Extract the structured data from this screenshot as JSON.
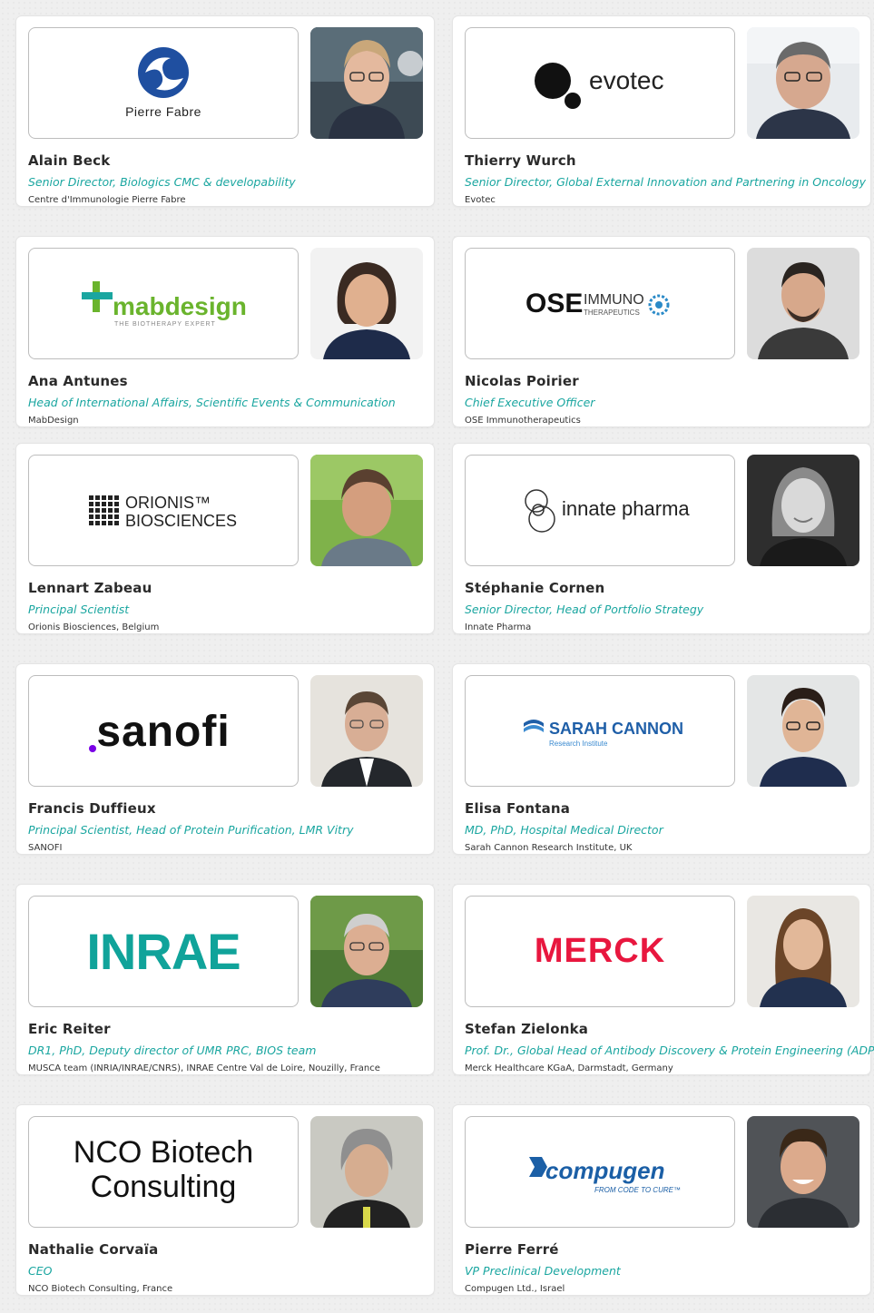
{
  "speakers": [
    {
      "name": "Alain Beck",
      "role": "Senior Director, Biologics CMC & developability",
      "org": "Centre d'Immunologie Pierre Fabre",
      "logo_text": "Pierre Fabre",
      "photo_icon": "person-portrait"
    },
    {
      "name": "Thierry Wurch",
      "role": "Senior Director, Global External Innovation and Partnering in Oncology",
      "org": "Evotec",
      "logo_text": "evotec",
      "photo_icon": "person-portrait"
    },
    {
      "name": "Ana Antunes",
      "role": "Head of International Affairs, Scientific Events & Communication",
      "org": "MabDesign",
      "logo_text": "mabdesign",
      "logo_sub": "THE BIOTHERAPY EXPERT",
      "photo_icon": "person-portrait"
    },
    {
      "name": "Nicolas Poirier",
      "role": "Chief Executive Officer",
      "org": "OSE Immunotherapeutics",
      "logo_text": "OSE",
      "logo_text2": "IMMUNO",
      "logo_sub": "THERAPEUTICS",
      "photo_icon": "person-portrait"
    },
    {
      "name": "Lennart Zabeau",
      "role": "Principal Scientist",
      "org": "Orionis Biosciences, Belgium",
      "logo_text": "ORIONIS™",
      "logo_text2": "BIOSCIENCES",
      "photo_icon": "person-portrait"
    },
    {
      "name": "Stéphanie Cornen",
      "role": "Senior Director, Head of Portfolio Strategy",
      "org": "Innate Pharma",
      "logo_text": "innate pharma",
      "photo_icon": "person-portrait"
    },
    {
      "name": "Francis Duffieux",
      "role": "Principal Scientist, Head of Protein Purification, LMR Vitry",
      "org": "SANOFI",
      "logo_text": "sanofi",
      "photo_icon": "person-portrait"
    },
    {
      "name": "Elisa Fontana",
      "role": "MD, PhD, Hospital Medical Director",
      "org": "Sarah Cannon Research Institute, UK",
      "logo_text": "SARAH CANNON",
      "logo_sub": "Research Institute",
      "photo_icon": "person-portrait"
    },
    {
      "name": "Eric Reiter",
      "role": "DR1, PhD, Deputy director of UMR PRC, BIOS team",
      "org": "MUSCA team (INRIA/INRAE/CNRS), INRAE Centre Val de Loire, Nouzilly, France",
      "logo_text": "INRAE",
      "photo_icon": "person-portrait"
    },
    {
      "name": "Stefan Zielonka",
      "role": "Prof. Dr., Global Head of Antibody Discovery & Protein Engineering (ADPE)",
      "org": "Merck Healthcare KGaA, Darmstadt, Germany",
      "logo_text": "MERCK",
      "photo_icon": "person-portrait"
    },
    {
      "name": "Nathalie Corvaïa",
      "role": "CEO",
      "org": "NCO Biotech Consulting, France",
      "logo_text": "NCO Biotech",
      "logo_text2": "Consulting",
      "photo_icon": "person-portrait"
    },
    {
      "name": "Pierre Ferré",
      "role": "VP Preclinical Development",
      "org": "Compugen Ltd., Israel",
      "logo_text": "compugen",
      "logo_sub": "FROM CODE TO CURE™",
      "photo_icon": "person-portrait"
    }
  ],
  "colors": {
    "accent": "#1aa6a0",
    "name": "#2b2b2b",
    "sanofi_dot": "#7a00e6",
    "merck": "#e8173f",
    "inrae": "#10a39a",
    "sarah": "#1f5fa8",
    "compugen": "#1b5fa6",
    "mabdesign": "#6ab42d"
  }
}
